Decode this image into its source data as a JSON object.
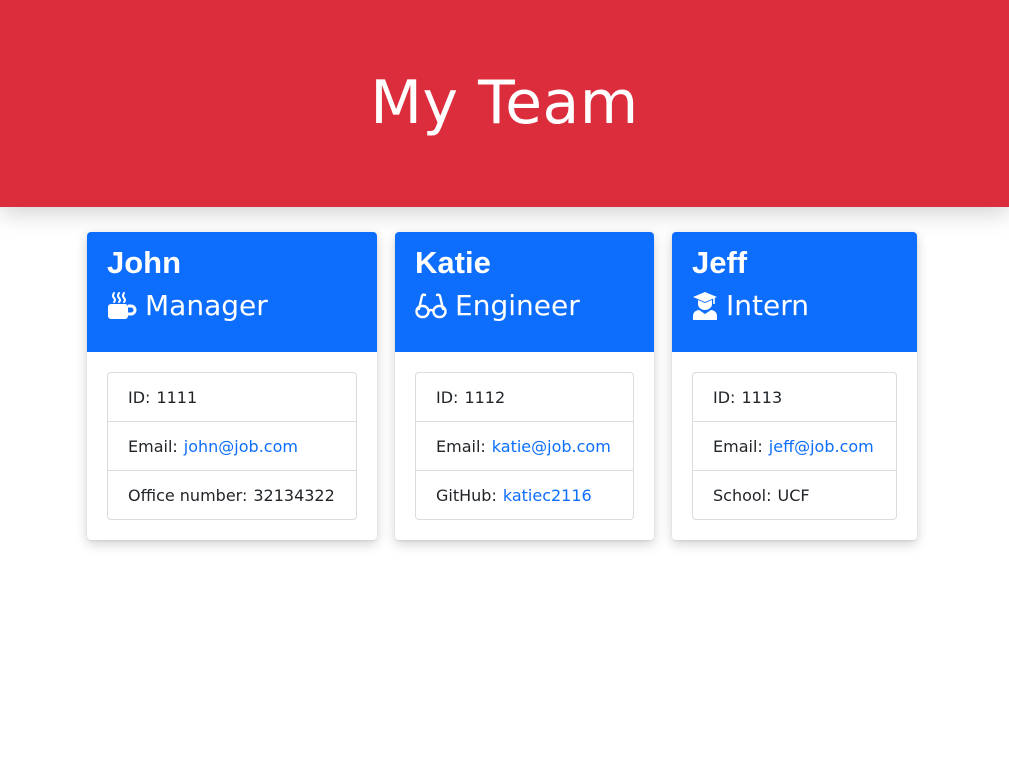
{
  "header": {
    "title": "My Team"
  },
  "colors": {
    "header_bg": "#dc2d3c",
    "card_head_bg": "#0d6efd",
    "link": "#0d6efd"
  },
  "cards": [
    {
      "name": "John",
      "role": "Manager",
      "role_icon": "coffee-mug-icon",
      "id_label": "ID:",
      "id": "1111",
      "email_label": "Email:",
      "email": "john@job.com",
      "extra_label": "Office number:",
      "extra": "32134322"
    },
    {
      "name": "Katie",
      "role": "Engineer",
      "role_icon": "glasses-icon",
      "id_label": "ID:",
      "id": "1112",
      "email_label": "Email:",
      "email": "katie@job.com",
      "extra_label": "GitHub:",
      "extra": "katiec2116"
    },
    {
      "name": "Jeff",
      "role": "Intern",
      "role_icon": "graduate-icon",
      "id_label": "ID:",
      "id": "1113",
      "email_label": "Email:",
      "email": "jeff@job.com",
      "extra_label": "School:",
      "extra": "UCF"
    }
  ]
}
